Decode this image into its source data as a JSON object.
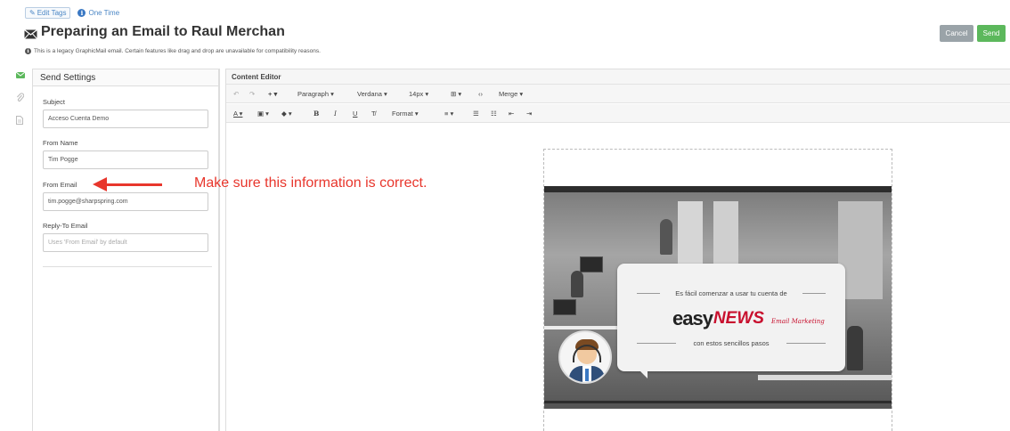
{
  "header": {
    "edit_tags_label": "Edit Tags",
    "one_time_label": "One Time",
    "title": "Preparing an Email to Raul Merchan",
    "legacy_note": "This is a legacy GraphicMail email. Certain features like drag and drop are unavailable for compatibility reasons.",
    "cancel_label": "Cancel",
    "send_label": "Send"
  },
  "sidebar_icons": [
    "envelope-icon",
    "paperclip-icon",
    "document-icon"
  ],
  "send_settings": {
    "title": "Send Settings",
    "subject_label": "Subject",
    "subject_value": "Acceso Cuenta Demo",
    "from_name_label": "From Name",
    "from_name_value": "Tim Pogge",
    "from_email_label": "From Email",
    "from_email_value": "tim.pogge@sharpspring.com",
    "reply_to_label": "Reply-To Email",
    "reply_to_placeholder": "Uses 'From Email' by default"
  },
  "editor": {
    "title": "Content Editor",
    "toolbar1": {
      "paragraph": "Paragraph",
      "font": "Verdana",
      "size": "14px",
      "merge": "Merge"
    },
    "toolbar2": {
      "bold": "B",
      "italic": "I",
      "underline": "U",
      "format": "Format"
    }
  },
  "email_preview": {
    "line1": "Es fácil comenzar a usar tu cuenta de",
    "logo_easy": "easy",
    "logo_news": "NEWS",
    "logo_sub": "Email Marketing",
    "line2": "con estos sencillos pasos"
  },
  "annotation": {
    "text": "Make sure this information is correct."
  },
  "colors": {
    "accent_blue": "#4a86c5",
    "send_green": "#5cb85c",
    "cancel_gray": "#9aa3a8",
    "annotation_red": "#e8362c",
    "logo_red": "#c8102e"
  }
}
